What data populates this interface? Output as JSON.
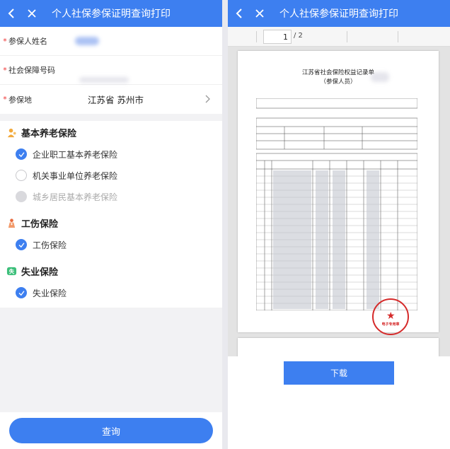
{
  "left": {
    "header": {
      "title": "个人社保参保证明查询打印"
    },
    "form": {
      "name": {
        "required": "*",
        "label": "参保人姓名",
        "value": ""
      },
      "ssn": {
        "required": "*",
        "label": "社会保障号码",
        "value": ""
      },
      "region": {
        "required": "*",
        "label": "参保地",
        "value": "江苏省 苏州市"
      }
    },
    "groups": [
      {
        "title": "基本养老保险",
        "icon": "pension-icon",
        "options": [
          {
            "label": "企业职工基本养老保险",
            "state": "checked"
          },
          {
            "label": "机关事业单位养老保险",
            "state": "unchecked"
          },
          {
            "label": "城乡居民基本养老保险",
            "state": "disabled"
          }
        ]
      },
      {
        "title": "工伤保险",
        "icon": "injury-icon",
        "options": [
          {
            "label": "工伤保险",
            "state": "checked"
          }
        ]
      },
      {
        "title": "失业保险",
        "icon": "unemployment-icon",
        "options": [
          {
            "label": "失业保险",
            "state": "checked"
          }
        ]
      }
    ],
    "query_button": "查询"
  },
  "right": {
    "header": {
      "title": "个人社保参保证明查询打印"
    },
    "pdf": {
      "current_page": "1",
      "total_pages": "/ 2",
      "doc_title": "江苏省社会保险权益记录单",
      "doc_subtitle": "（参保人员）",
      "stamp_text": "电子专用章"
    },
    "download_button": "下载"
  },
  "colors": {
    "accent": "#3d7ff0",
    "required": "#e33333",
    "stamp": "#d52a2a"
  }
}
